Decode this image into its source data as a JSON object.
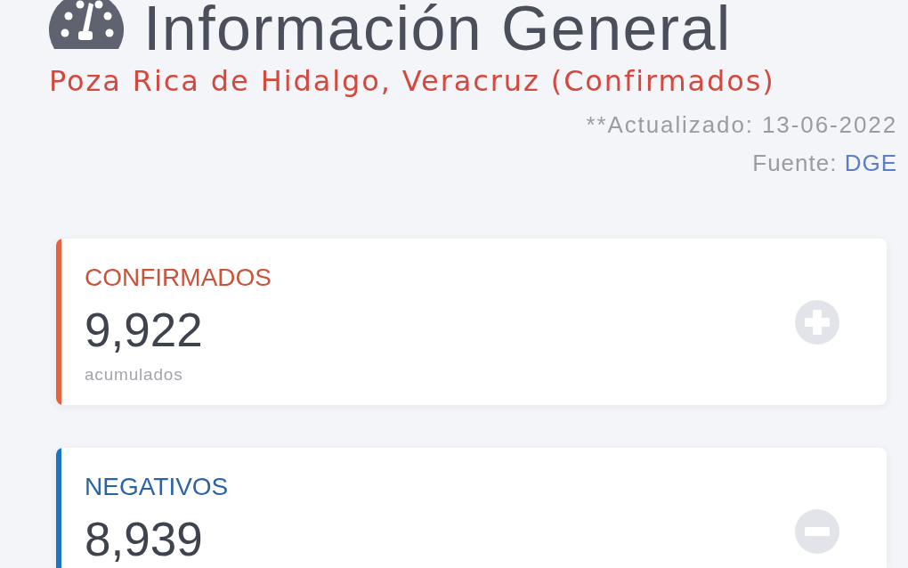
{
  "header": {
    "title": "Información General",
    "subtitle": "Poza Rica de Hidalgo, Veracruz (Confirmados)",
    "updated": "**Actualizado: 13-06-2022",
    "source_label": "Fuente:",
    "source_link": "DGE"
  },
  "cards": [
    {
      "label": "CONFIRMADOS",
      "value": "9,922",
      "caption": "acumulados",
      "color": "#e8603c",
      "kind": "plus"
    },
    {
      "label": "NEGATIVOS",
      "value": "8,939",
      "color": "#1c74c9",
      "kind": "minus"
    }
  ]
}
